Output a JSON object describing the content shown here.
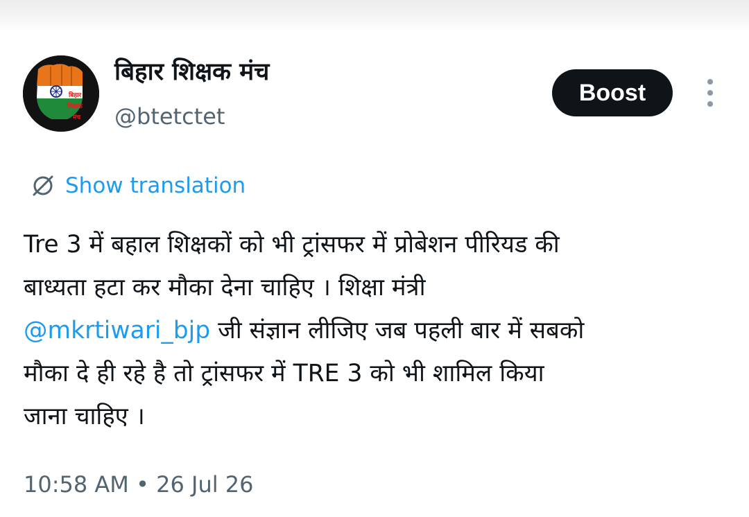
{
  "account": {
    "display_name": "बिहार शिक्षक मंच",
    "handle": "@btetctet",
    "avatar_text": [
      "बिहार",
      "शिक्षक",
      "मंच"
    ]
  },
  "actions": {
    "boost_label": "Boost",
    "more_icon": "three-dots-vertical-icon"
  },
  "translation": {
    "icon": "globe-slash-icon",
    "label": "Show translation"
  },
  "tweet": {
    "line1": "Tre 3 में बहाल शिक्षकों को भी ट्रांसफर में प्रोबेशन पीरियड की",
    "line2": "बाध्यता हटा कर मौका देना चाहिए । शिक्षा मंत्री",
    "mention": "@mkrtiwari_bjp",
    "line3_rest": " जी संज्ञान लीजिए जब पहली बार में सबको",
    "line4": "मौका दे ही रहे है तो ट्रांसफर में TRE 3 को भी शामिल किया",
    "line5": "जाना चाहिए ।"
  },
  "meta": {
    "timestamp": "10:58 AM • 26 Jul 26"
  },
  "colors": {
    "link": "#1d9bf0",
    "secondary_text": "#536471",
    "primary_text": "#0f1419",
    "button_bg": "#0f1419"
  }
}
